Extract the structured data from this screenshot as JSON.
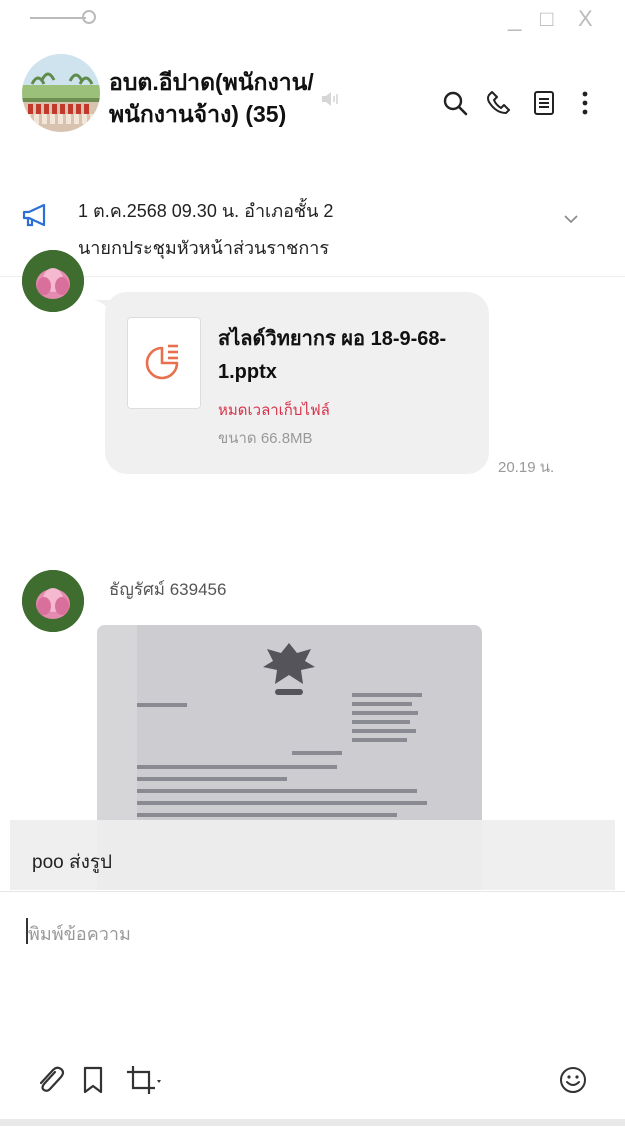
{
  "window": {
    "minimize_label": "_",
    "maximize_label": "□",
    "close_label": "X"
  },
  "header": {
    "title": "อบต.อีปาด(พนักงาน/พนักงานจ้าง) (35)",
    "icons": [
      "search-icon",
      "phone-icon",
      "notes-icon",
      "more-icon"
    ]
  },
  "announcement": {
    "line1": "1 ต.ค.2568 09.30 น. อำเภอชั้น 2",
    "line2": "นายกประชุมหัวหน้าส่วนราชการ"
  },
  "messages": [
    {
      "type": "file",
      "file_name": "สไลด์วิทยากร ผอ 18-9-68-1.pptx",
      "status": "หมดเวลาเก็บไฟล์",
      "size": "ขนาด 66.8MB",
      "time": "20.19 น."
    },
    {
      "type": "image",
      "sender": "ธัญรัศม์ 639456"
    }
  ],
  "reply_preview": {
    "text": "poo ส่งรูป"
  },
  "input": {
    "placeholder": "พิมพ์ข้อความ"
  },
  "toolbar": {
    "icons": [
      "attach-icon",
      "keep-icon",
      "screenshot-icon",
      "emoji-icon"
    ]
  },
  "colors": {
    "accent": "#2d6fd6",
    "expired": "#d6334a",
    "file_icon": "#e8704c",
    "bubble": "#f0f0f0"
  }
}
